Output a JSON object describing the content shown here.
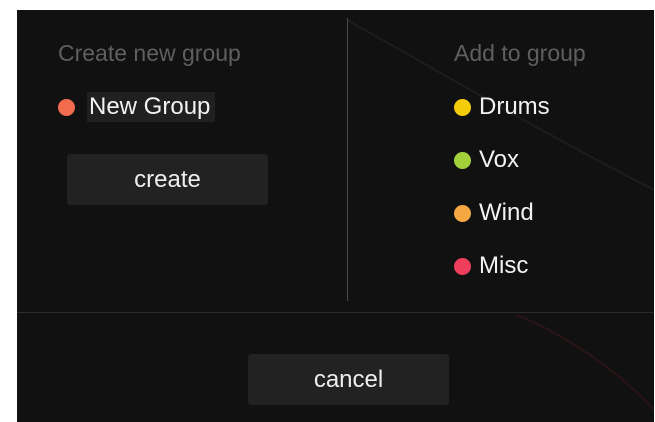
{
  "dialog": {
    "create_section": {
      "heading": "Create new group",
      "new_group_name": "New Group",
      "new_group_color": "#f26b4f",
      "create_label": "create"
    },
    "add_section": {
      "heading": "Add to group",
      "groups": [
        {
          "label": "Drums",
          "color": "#f5cc0a"
        },
        {
          "label": "Vox",
          "color": "#a3d13b"
        },
        {
          "label": "Wind",
          "color": "#f5a742"
        },
        {
          "label": "Misc",
          "color": "#ef3d5c"
        }
      ]
    },
    "cancel_label": "cancel"
  }
}
